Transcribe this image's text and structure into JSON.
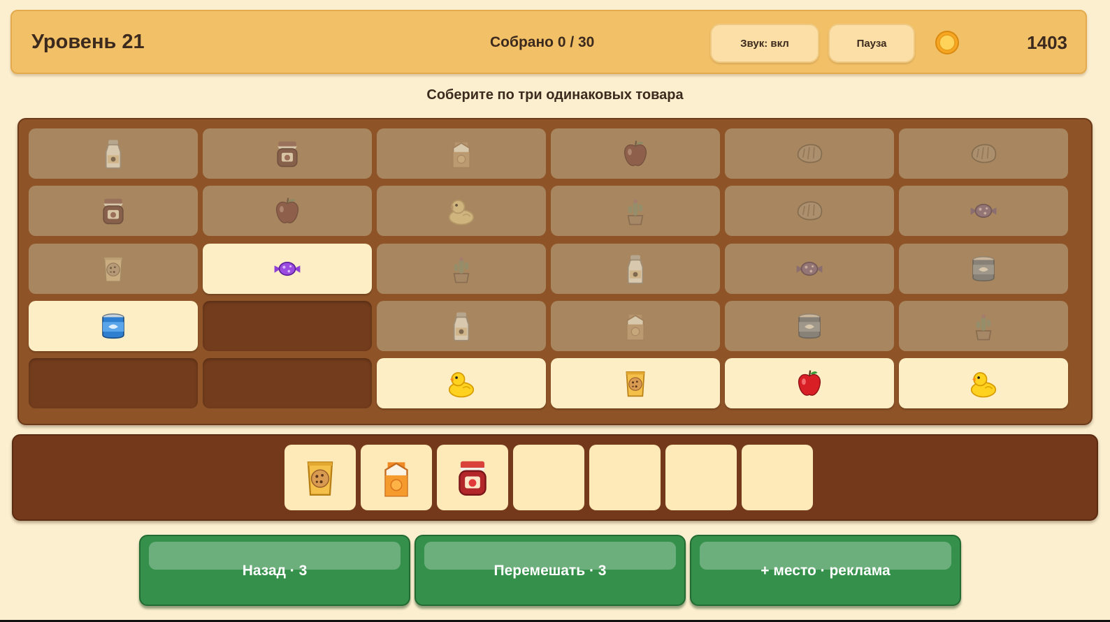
{
  "header": {
    "level": "Уровень 21",
    "collected": "Собрано 0 / 30",
    "sound_label": "Звук: вкл",
    "pause_label": "Пауза",
    "coins": "1403"
  },
  "hint": "Соберите по три одинаковых товара",
  "board": {
    "rows": [
      [
        {
          "item": "milk-bottle",
          "state": "blocked"
        },
        {
          "item": "jam-jar",
          "state": "blocked"
        },
        {
          "item": "juice-carton",
          "state": "blocked"
        },
        {
          "item": "apple",
          "state": "blocked"
        },
        {
          "item": "bread",
          "state": "blocked"
        },
        {
          "item": "bread",
          "state": "blocked"
        }
      ],
      [
        {
          "item": "jam-jar",
          "state": "blocked"
        },
        {
          "item": "apple",
          "state": "blocked"
        },
        {
          "item": "rubber-duck",
          "state": "blocked"
        },
        {
          "item": "cactus-pot",
          "state": "blocked"
        },
        {
          "item": "bread",
          "state": "blocked"
        },
        {
          "item": "candy",
          "state": "blocked"
        }
      ],
      [
        {
          "item": "cookie-bag",
          "state": "blocked"
        },
        {
          "item": "candy",
          "state": "active"
        },
        {
          "item": "cactus-pot",
          "state": "blocked"
        },
        {
          "item": "milk-bottle",
          "state": "blocked"
        },
        {
          "item": "candy",
          "state": "blocked"
        },
        {
          "item": "tin-can",
          "state": "blocked"
        }
      ],
      [
        {
          "item": "tin-can",
          "state": "active"
        },
        {
          "item": "",
          "state": "empty"
        },
        {
          "item": "milk-bottle",
          "state": "blocked"
        },
        {
          "item": "juice-carton",
          "state": "blocked"
        },
        {
          "item": "tin-can",
          "state": "blocked"
        },
        {
          "item": "cactus-pot",
          "state": "blocked"
        }
      ],
      [
        {
          "item": "",
          "state": "empty"
        },
        {
          "item": "",
          "state": "empty"
        },
        {
          "item": "rubber-duck",
          "state": "active"
        },
        {
          "item": "cookie-bag",
          "state": "active"
        },
        {
          "item": "apple",
          "state": "active"
        },
        {
          "item": "rubber-duck",
          "state": "active"
        }
      ]
    ]
  },
  "tray": {
    "slots": [
      "cookie-bag",
      "juice-carton",
      "jam-jar",
      "",
      "",
      "",
      ""
    ]
  },
  "actions": {
    "undo_label": "Назад · 3",
    "shuffle_label": "Перемешать · 3",
    "extra_slot_label": "+ место · реклама"
  },
  "colors": {
    "accent": "#f2c067",
    "board": "#8e5428",
    "button_green": "#34904a"
  }
}
